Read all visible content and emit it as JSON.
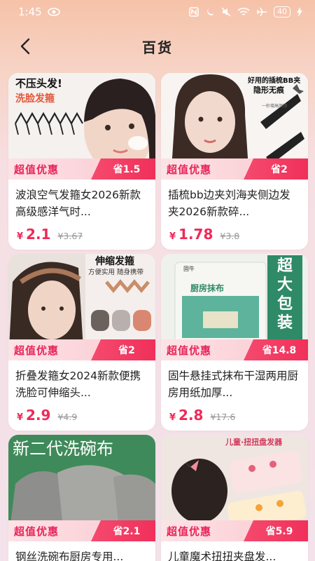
{
  "status": {
    "time": "1:45",
    "battery": "40"
  },
  "nav": {
    "title": "百货"
  },
  "products": [
    {
      "promo": "超值优惠",
      "save": "省1.5",
      "title": "波浪空气发箍女2026新款高级感洋气时...",
      "currency": "¥",
      "price": "2.1",
      "old_price": "¥3.67",
      "thumb_texts": [
        "不压头发!",
        "洗脸发箍"
      ]
    },
    {
      "promo": "超值优惠",
      "save": "省2",
      "title": "插梳bb边夹刘海夹侧边发夹2026新款碎...",
      "currency": "¥",
      "price": "1.78",
      "old_price": "¥3.8",
      "thumb_texts": [
        "好用的插梳BB夹",
        "隐形无痕",
        "一秒增高颅顶"
      ]
    },
    {
      "promo": "超值优惠",
      "save": "省2",
      "title": "折叠发箍女2024新款便携洗脸可伸缩头...",
      "currency": "¥",
      "price": "2.9",
      "old_price": "¥4.9",
      "thumb_texts": [
        "伸缩发箍",
        "方便实用 随身携带"
      ]
    },
    {
      "promo": "超值优惠",
      "save": "省14.8",
      "title": "固牛悬挂式抹布干湿两用厨房用纸加厚...",
      "currency": "¥",
      "price": "2.8",
      "old_price": "¥17.6",
      "thumb_texts": [
        "超大包装",
        "厨房抹布",
        "固牛"
      ]
    },
    {
      "promo": "超值优惠",
      "save": "省2.1",
      "title": "钢丝洗碗布厨房专用...",
      "currency": "¥",
      "price": "",
      "old_price": "",
      "thumb_texts": [
        "新二代洗碗布"
      ]
    },
    {
      "promo": "超值优惠",
      "save": "省5.9",
      "title": "儿童魔术扭扭夹盘发...",
      "currency": "¥",
      "price": "",
      "old_price": "",
      "thumb_texts": [
        "儿童·扭扭盘发器"
      ]
    }
  ]
}
